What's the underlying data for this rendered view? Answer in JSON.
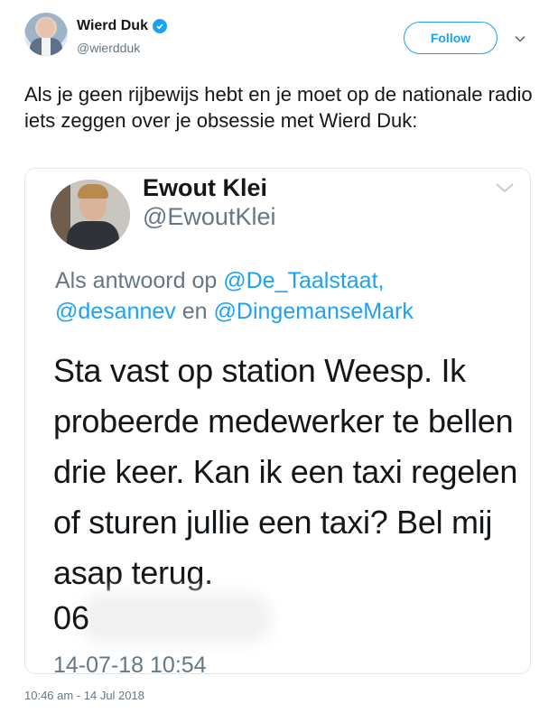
{
  "tweet": {
    "author": {
      "display_name": "Wierd Duk",
      "handle": "@wierdduk",
      "verified": true
    },
    "follow_label": "Follow",
    "text": "Als je geen rijbewijs hebt en je moet op de nationale radio iets zeggen over je obsessie met Wierd Duk:",
    "timestamp": "10:46 am - 14 Jul 2018"
  },
  "embedded": {
    "display_name": "Ewout Klei",
    "handle": "@EwoutKlei",
    "reply_prefix": "Als antwoord op",
    "mention_1": "@De_Taalstaat,",
    "mention_2": "@desannev",
    "reply_joiner": "en",
    "mention_3": "@DingemanseMark",
    "body": "Sta vast op station Weesp. Ik probeerde medewerker te bellen drie keer. Kan ik een taxi regelen of sturen jullie een taxi? Bel mij asap terug.",
    "phone_prefix": "06",
    "date": "14-07-18 10:54"
  },
  "colors": {
    "accent": "#1da1f2",
    "secondary_text": "#657786"
  },
  "icons": [
    "verified-icon",
    "chevron-down-icon"
  ]
}
